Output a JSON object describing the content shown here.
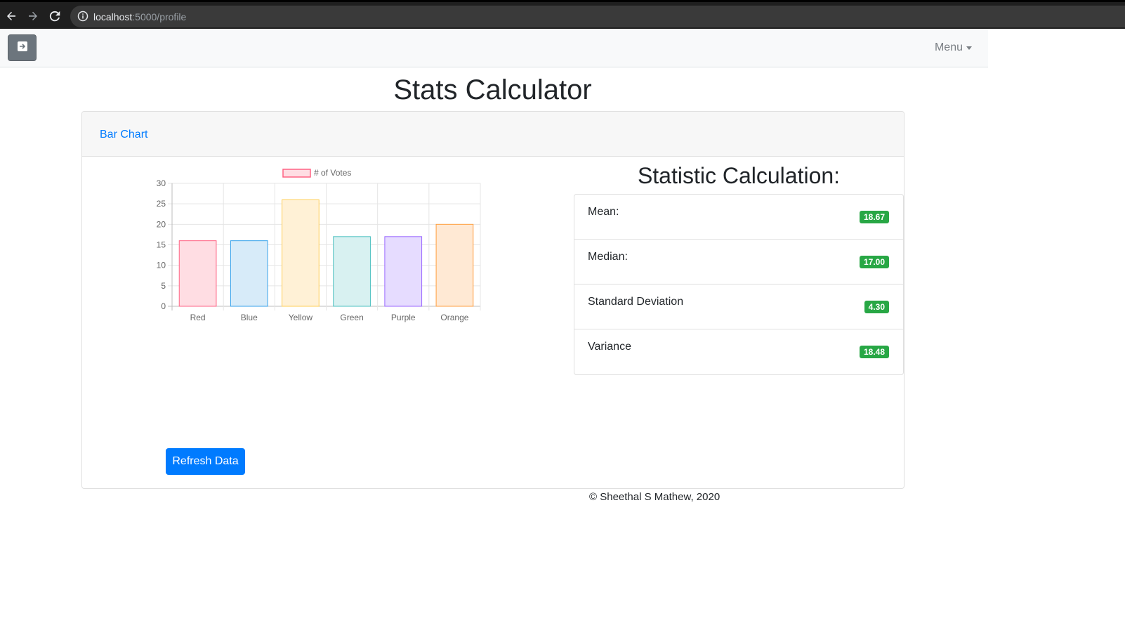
{
  "browser": {
    "url_host": "localhost",
    "url_path": ":5000/profile"
  },
  "navbar": {
    "menu_label": "Menu"
  },
  "page": {
    "title": "Stats Calculator"
  },
  "card": {
    "tab_label": "Bar Chart",
    "refresh_label": "Refresh Data"
  },
  "stats": {
    "title": "Statistic Calculation:",
    "items": [
      {
        "label": "Mean:",
        "value": "18.67"
      },
      {
        "label": "Median:",
        "value": "17.00"
      },
      {
        "label": "Standard Deviation",
        "value": "4.30"
      },
      {
        "label": "Variance",
        "value": "18.48"
      }
    ]
  },
  "footer": {
    "text": "© Sheethal S Mathew, 2020"
  },
  "chart_data": {
    "type": "bar",
    "categories": [
      "Red",
      "Blue",
      "Yellow",
      "Green",
      "Purple",
      "Orange"
    ],
    "series": [
      {
        "name": "# of Votes",
        "values": [
          16,
          16,
          26,
          17,
          17,
          20
        ]
      }
    ],
    "ylim": [
      0,
      30
    ],
    "yticks": [
      0,
      5,
      10,
      15,
      20,
      25,
      30
    ],
    "grid": true,
    "legend": "top",
    "colors": {
      "fills": [
        "#ffdde3",
        "#d7ebf9",
        "#fff1d6",
        "#d8f1f1",
        "#e6dcff",
        "#ffe9d4"
      ],
      "strokes": [
        "#ff6384",
        "#36a2eb",
        "#ffce56",
        "#4bc0c0",
        "#9966ff",
        "#ff9f40"
      ]
    }
  }
}
